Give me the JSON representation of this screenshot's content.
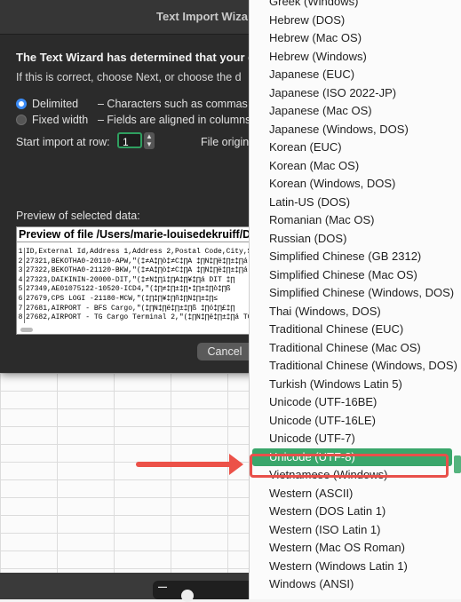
{
  "dialog": {
    "title": "Text Import Wiza",
    "heading": "The Text Wizard has determined that your d",
    "subtext": "If this is correct, choose Next, or choose the d",
    "delimited_label": "Delimited",
    "delimited_desc": "– Characters such as commas",
    "fixed_label": "Fixed width",
    "fixed_desc": "– Fields are aligned in columns",
    "start_row_label": "Start import at row:",
    "start_row_value": "1",
    "file_origin_label": "File origin",
    "preview_label": "Preview of selected data:",
    "preview_title": "Preview of file /Users/marie-louisedekruiff/Do",
    "preview_rows": [
      {
        "n": "1",
        "text": "ID,External Id,Address 1,Address 2,Postal Code,City,St"
      },
      {
        "n": "2",
        "text": "27321,BEKOTHA0-20110-APW,\"(‡≠A‡∏ò‡≠C‡∏A ‡∏N‡∏ë‡∏±‡∏á"
      },
      {
        "n": "3",
        "text": "27322,BEKOTHA0-21120-BKW,\"(‡≠A‡∏ò‡≠C‡∏A ‡∏N‡∏ë‡∏±‡∏á"
      },
      {
        "n": "4",
        "text": "27323,DAIKININ-20000-DIT,\"(‡≠N‡∏ì‡∏A‡∏¥‡∏á DIT ‡∏"
      },
      {
        "n": "5",
        "text": "27349,AE01075122-10520-ICD4,\"(‡∏≠‡∏±‡∏•‡∏±‡∏ò‡∏ß"
      },
      {
        "n": "6",
        "text": "27679,CPS LOGI -21180-MCW,\"(‡∏‡∏¥‡∏ñ‡∏N‡∏±‡∏≤"
      },
      {
        "n": "7",
        "text": "27681,AIRPORT - BFS Cargo,\"(‡∏N‡∏ë‡∏±‡∏ß ‡∏ó‡∏£‡∏"
      },
      {
        "n": "8",
        "text": "27682,AIRPORT - TG Cargo Terminal 2,\"(‡∏N‡∏ë‡∏±‡∏á TG"
      }
    ],
    "cancel_label": "Cancel"
  },
  "menu": {
    "items": [
      "Greek (Windows)",
      "Hebrew (DOS)",
      "Hebrew (Mac OS)",
      "Hebrew (Windows)",
      "Japanese (EUC)",
      "Japanese (ISO 2022-JP)",
      "Japanese (Mac OS)",
      "Japanese (Windows, DOS)",
      "Korean (EUC)",
      "Korean (Mac OS)",
      "Korean (Windows, DOS)",
      "Latin-US (DOS)",
      "Romanian (Mac OS)",
      "Russian (DOS)",
      "Simplified Chinese (GB 2312)",
      "Simplified Chinese (Mac OS)",
      "Simplified Chinese (Windows, DOS)",
      "Thai (Windows, DOS)",
      "Traditional Chinese (EUC)",
      "Traditional Chinese (Mac OS)",
      "Traditional Chinese (Windows, DOS)",
      "Turkish (Windows Latin 5)",
      "Unicode (UTF-16BE)",
      "Unicode (UTF-16LE)",
      "Unicode (UTF-7)",
      "Unicode (UTF-8)",
      "Vietnamese (Windows)",
      "Western (ASCII)",
      "Western (DOS Latin 1)",
      "Western (ISO Latin 1)",
      "Western (Mac OS Roman)",
      "Western (Windows Latin 1)",
      "Windows (ANSI)"
    ],
    "selected": "Unicode (UTF-8)"
  },
  "colors": {
    "selection": "#3aa66b",
    "annotation": "#ec5148",
    "radio_accent": "#3b8bf5"
  }
}
